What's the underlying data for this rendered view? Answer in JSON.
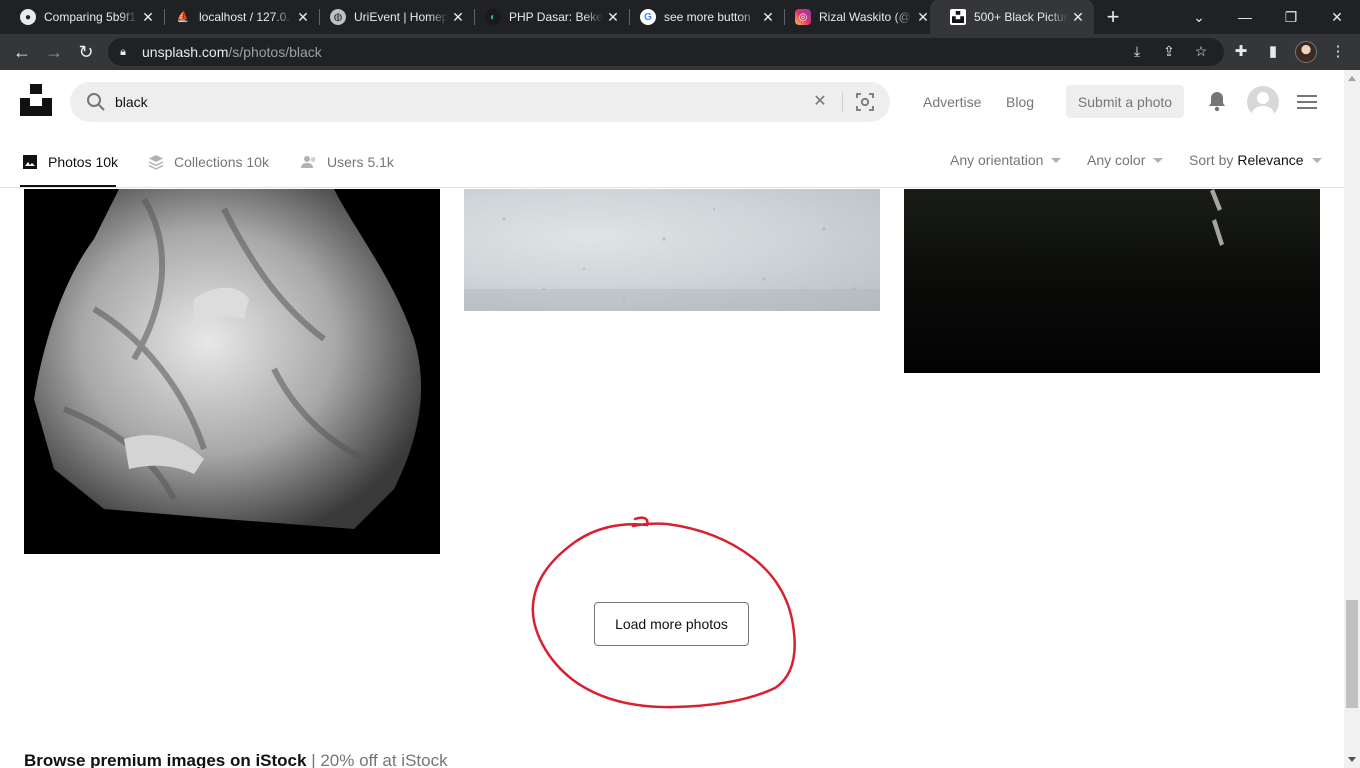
{
  "browser": {
    "tabs": [
      {
        "title": "Comparing 5b9f1",
        "icon": "github-icon"
      },
      {
        "title": "localhost / 127.0.",
        "icon": "phpmyadmin-icon"
      },
      {
        "title": "UriEvent | Homep",
        "icon": "globe-icon"
      },
      {
        "title": "PHP Dasar: Beker",
        "icon": "codepolitan-icon"
      },
      {
        "title": "see more button",
        "icon": "google-icon"
      },
      {
        "title": "Rizal Waskito (@",
        "icon": "instagram-icon"
      },
      {
        "title": "500+ Black Pictur",
        "icon": "unsplash-icon",
        "active": true
      }
    ],
    "url_domain": "unsplash.com",
    "url_path": "/s/photos/black"
  },
  "header": {
    "search_value": "black",
    "advertise": "Advertise",
    "blog": "Blog",
    "submit_label": "Submit a photo"
  },
  "filters": {
    "tabs": [
      {
        "label": "Photos 10k",
        "active": true
      },
      {
        "label": "Collections 10k"
      },
      {
        "label": "Users 5.1k"
      }
    ],
    "orientation": "Any orientation",
    "color": "Any color",
    "sort_prefix": "Sort by",
    "sort_value": "Relevance"
  },
  "main": {
    "load_more_label": "Load more photos",
    "istock_bold": "Browse premium images on iStock",
    "istock_sub": "| 20% off at iStock"
  },
  "colors": {
    "annotation": "#d9202e",
    "chrome_dark": "#202124",
    "chrome_toolbar": "#35363a"
  }
}
